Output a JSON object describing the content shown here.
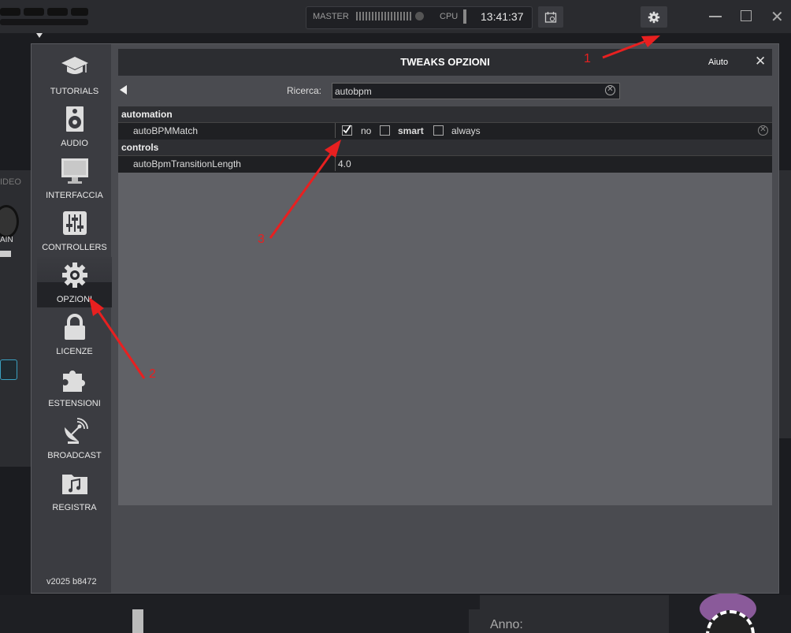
{
  "topbar": {
    "master_label": "MASTER",
    "cpu_label": "CPU",
    "clock": "13:41:37"
  },
  "background": {
    "video_tab": "IDEO",
    "gain_label": "AIN",
    "anno_label": "Anno:"
  },
  "sidebar": {
    "items": [
      {
        "label": "TUTORIALS",
        "icon": "graduation-cap-icon"
      },
      {
        "label": "AUDIO",
        "icon": "speaker-icon"
      },
      {
        "label": "INTERFACCIA",
        "icon": "monitor-icon"
      },
      {
        "label": "CONTROLLERS",
        "icon": "sliders-icon"
      },
      {
        "label": "OPZIONI",
        "icon": "gear-icon",
        "active": true
      },
      {
        "label": "LICENZE",
        "icon": "lock-icon"
      },
      {
        "label": "ESTENSIONI",
        "icon": "puzzle-icon"
      },
      {
        "label": "BROADCAST",
        "icon": "satellite-dish-icon"
      },
      {
        "label": "REGISTRA",
        "icon": "music-folder-icon"
      }
    ],
    "version": "v2025 b8472"
  },
  "dialog": {
    "title": "TWEAKS OPZIONI",
    "help": "Aiuto",
    "close": "✕"
  },
  "search": {
    "label": "Ricerca:",
    "value": "autobpm"
  },
  "sections": [
    {
      "name": "automation",
      "options": [
        {
          "name": "autoBPMMatch",
          "choices": [
            {
              "label": "no",
              "checked": true
            },
            {
              "label": "smart",
              "checked": false
            },
            {
              "label": "always",
              "checked": false
            }
          ]
        }
      ]
    },
    {
      "name": "controls",
      "options": [
        {
          "name": "autoBpmTransitionLength",
          "value": "4.0"
        }
      ]
    }
  ],
  "annotations": [
    "1",
    "2",
    "3"
  ],
  "colors": {
    "annotation": "#e82020",
    "dialog_bg": "#4a4b50",
    "header_bg": "#2c2d31"
  }
}
